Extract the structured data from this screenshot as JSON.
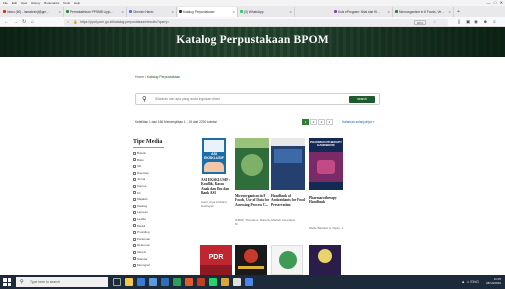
{
  "browser": {
    "menu_items": [
      "File",
      "Edit",
      "View",
      "History",
      "Bookmarks",
      "Tools",
      "Help"
    ],
    "tabs": [
      {
        "label": "Inbox (60) - lamakrimjl@gm...",
        "favicon_color": "#d93025",
        "active": false
      },
      {
        "label": "Permutakhiran PPSMB Upjo...",
        "favicon_color": "#2a8c3a",
        "active": false
      },
      {
        "label": "Obrolan Hasio",
        "favicon_color": "#3c7bd6",
        "active": false
      },
      {
        "label": "Katalog Perpustakaan",
        "favicon_color": "#1c3a28",
        "active": true
      },
      {
        "label": "(3) WhatsApp",
        "favicon_color": "#25d366",
        "active": false
      },
      {
        "label": "Kuis eProgram: Nilai dari KI...",
        "favicon_color": "#8e44ad",
        "active": false
      },
      {
        "label": "Microorganism in 8 Foods, Ve...",
        "favicon_color": "#2e7d32",
        "active": false
      }
    ],
    "new_tab": "+",
    "url": "https://ppid.pom.go.id/katalog-perpustakaan/results?query=",
    "zoom": "90%"
  },
  "page": {
    "site_title": "Katalog Perpustakaan BPOM",
    "breadcrumb_home": "Home",
    "breadcrumb_sep": "/",
    "breadcrumb_current": "Katalog Perpustakaan",
    "search_placeholder": "Silahkan cari apa yang anda inginkan disini",
    "search_button": "search",
    "results_text": "Ketelitian 1 dari 166 Menampilkan 1 - 15 dari 2230 koleksi",
    "pages": [
      "1",
      "2",
      "3",
      "4"
    ],
    "next_text": "Halaman selanjutnya »",
    "facet_title": "Tipe Media",
    "facets": [
      "Buletin",
      "Buku",
      "CD",
      "Disertasi",
      "Jurnal",
      "Kamus",
      "Kit",
      "Majalah",
      "Katalog",
      "Laporan",
      "Leaflet",
      "Modul",
      "Prosiding",
      "Peraturan",
      "Referensi",
      "Skripsi",
      "Standar",
      "Monograf"
    ]
  },
  "books": [
    {
      "cover_text": "ASI EKSKLUSIF",
      "title": "ASI EKSKLUSIF : Konflik, Kasus Anak dan Ibu dan Bank ASI",
      "author": "Aneh, Arya Andriani, Nurhayati"
    },
    {
      "cover_text": "",
      "title": "Microorganism in 8 Foods, Use of Data for Assessing Process C...",
      "author": "ICMSF, Thomas A. Roberts, M."
    },
    {
      "cover_text": "",
      "title": "Handbook of Antioxidants for Food Preservation",
      "author": "Shahidi, Fereidoon"
    },
    {
      "cover_text": "PHARMACOTHERAPY HANDBOOK",
      "title": "Pharmacotherapy Handbook",
      "author": "Wells, Barbara G. Dipiro, J."
    },
    {
      "cover_text": "PDR",
      "title": "",
      "author": ""
    },
    {
      "cover_text": "",
      "title": "",
      "author": ""
    },
    {
      "cover_text": "",
      "title": "",
      "author": ""
    },
    {
      "cover_text": "",
      "title": "",
      "author": ""
    }
  ],
  "taskbar": {
    "search_placeholder": "Type here to search",
    "time": "11:05",
    "date": "28/10/2020",
    "language": "ENG"
  },
  "colors": {
    "header_green": "#1c3a28",
    "accent_green": "#1e5a30",
    "taskbar": "#1d2a3a",
    "link_blue": "#1f5fa8"
  }
}
